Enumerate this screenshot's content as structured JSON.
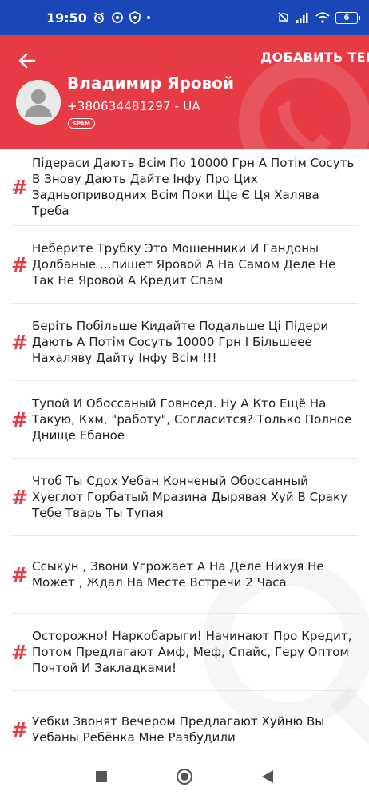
{
  "status_bar": {
    "time": "19:50",
    "battery": "6",
    "icons": [
      "alarm-icon",
      "browser-icon",
      "shield-icon",
      "dot-icon",
      "mute-icon",
      "signal-icon",
      "wifi-icon",
      "battery-icon"
    ]
  },
  "header": {
    "add_tag_label": "ДОБАВИТЬ ТЕГ",
    "name": "Владимир Яровой",
    "phone": "+380634481297 - UA",
    "badge": "SPAM",
    "background_color": "#e63a44"
  },
  "comments": [
    {
      "icon": "#",
      "text": "Підераси Дають Всім По 10000 Грн А Потім Сосуть В Знову Дають Дайте Інфу Про Цих Задньоприводних Всім Поки Ще Є Ця Халява Треба"
    },
    {
      "icon": "#",
      "text": "Неберите Трубку Это Мошенники И Гандоны Долбаные ...пишет Яровой А На Самом Деле Не Так Не Яровой А Кредит Спам"
    },
    {
      "icon": "#",
      "text": "Беріть Побільше Кидайте Подальше Ці Підери Дають А Потім Сосуть 10000 Грн І Більшееe Нахаляву Дайту Інфу Всім !!!"
    },
    {
      "icon": "#",
      "text": "Тупой И Обоссаный Говноед. Ну А Кто Ещё На Такую, Кхм, \"работу\", Согласится? Только Полное Днище Ебаное"
    },
    {
      "icon": "#",
      "text": "Чтоб Ты Сдох Уебан Конченый Обоссанный Хуеглот Горбатый Мразина Дырявая Хуй В Сраку Тебе Тварь Ты Тупая"
    },
    {
      "icon": "#",
      "text": "Ссыкун , Звони Угрожает А На Деле Нихуя Не Может , Ждал На Месте Встречи 2 Часа"
    },
    {
      "icon": "#",
      "text": "Осторожно! Наркобарыги! Начинают Про Кредит, Потом Предлагают Амф, Меф, Спайс, Геру Оптом Почтой И Закладками!"
    },
    {
      "icon": "#",
      "text": "Уебки Звонят Вечером Предлагают Хуйню Вы Уебаны Ребёнка Мне Разбудили"
    }
  ],
  "accent_color": "#e63a44",
  "status_bar_color": "#1947b8"
}
